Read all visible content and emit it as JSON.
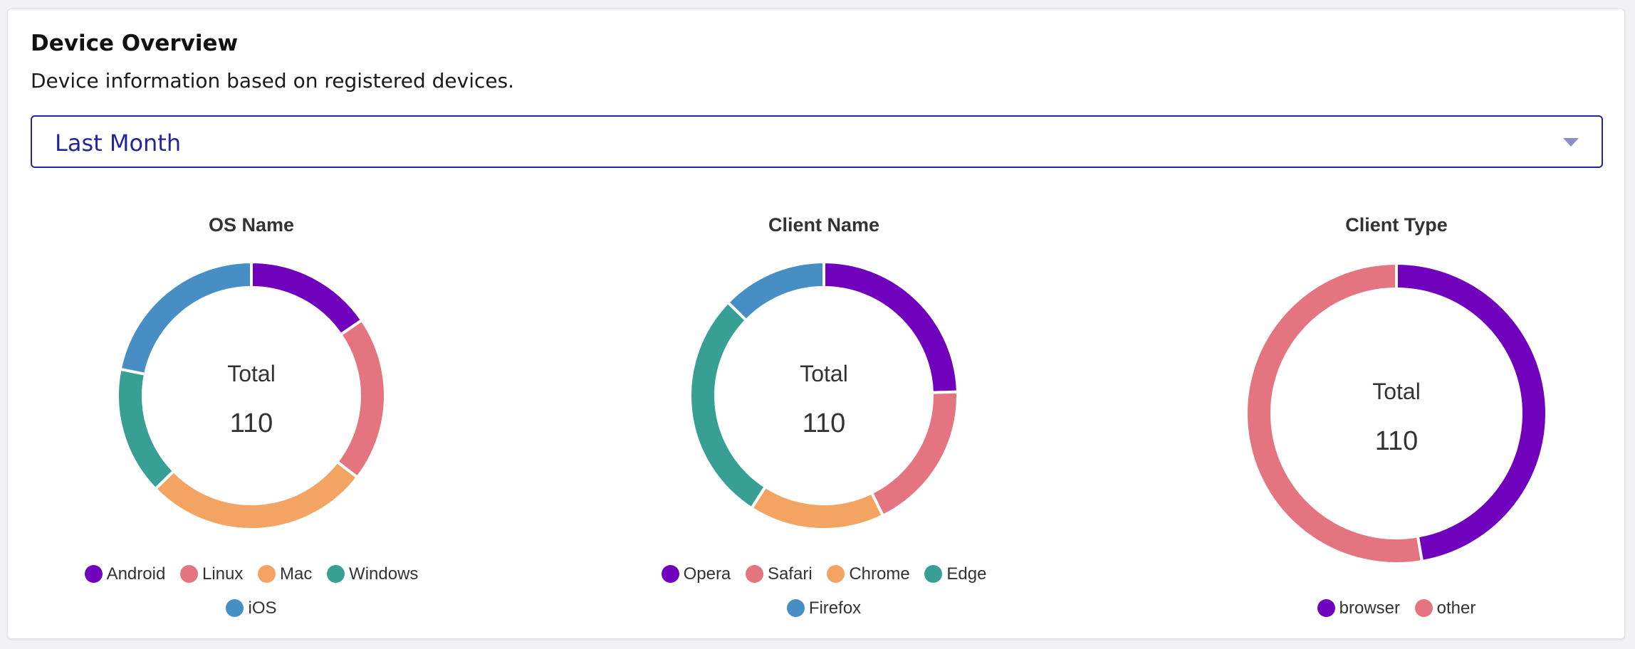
{
  "header": {
    "title": "Device Overview",
    "subtitle": "Device information based on registered devices."
  },
  "period_select": {
    "selected": "Last Month"
  },
  "colors": {
    "purple": "#7002bd",
    "red": "#e47480",
    "orange": "#f3a462",
    "teal": "#379f93",
    "blue": "#478ec5"
  },
  "chart_data": [
    {
      "type": "pie",
      "title": "OS Name",
      "center_label": "Total",
      "total": "110",
      "categories": [
        "Android",
        "Linux",
        "Mac",
        "Windows",
        "iOS"
      ],
      "values": [
        17,
        22,
        30,
        17,
        24
      ],
      "colors": [
        "#7002bd",
        "#e47480",
        "#f3a462",
        "#379f93",
        "#478ec5"
      ]
    },
    {
      "type": "pie",
      "title": "Client Name",
      "center_label": "Total",
      "total": "110",
      "categories": [
        "Opera",
        "Safari",
        "Chrome",
        "Edge",
        "Firefox"
      ],
      "values": [
        27,
        20,
        18,
        31,
        14
      ],
      "colors": [
        "#7002bd",
        "#e47480",
        "#f3a462",
        "#379f93",
        "#478ec5"
      ]
    },
    {
      "type": "pie",
      "title": "Client Type",
      "center_label": "Total",
      "total": "110",
      "categories": [
        "browser",
        "other"
      ],
      "values": [
        52,
        58
      ],
      "colors": [
        "#7002bd",
        "#e47480"
      ]
    }
  ]
}
